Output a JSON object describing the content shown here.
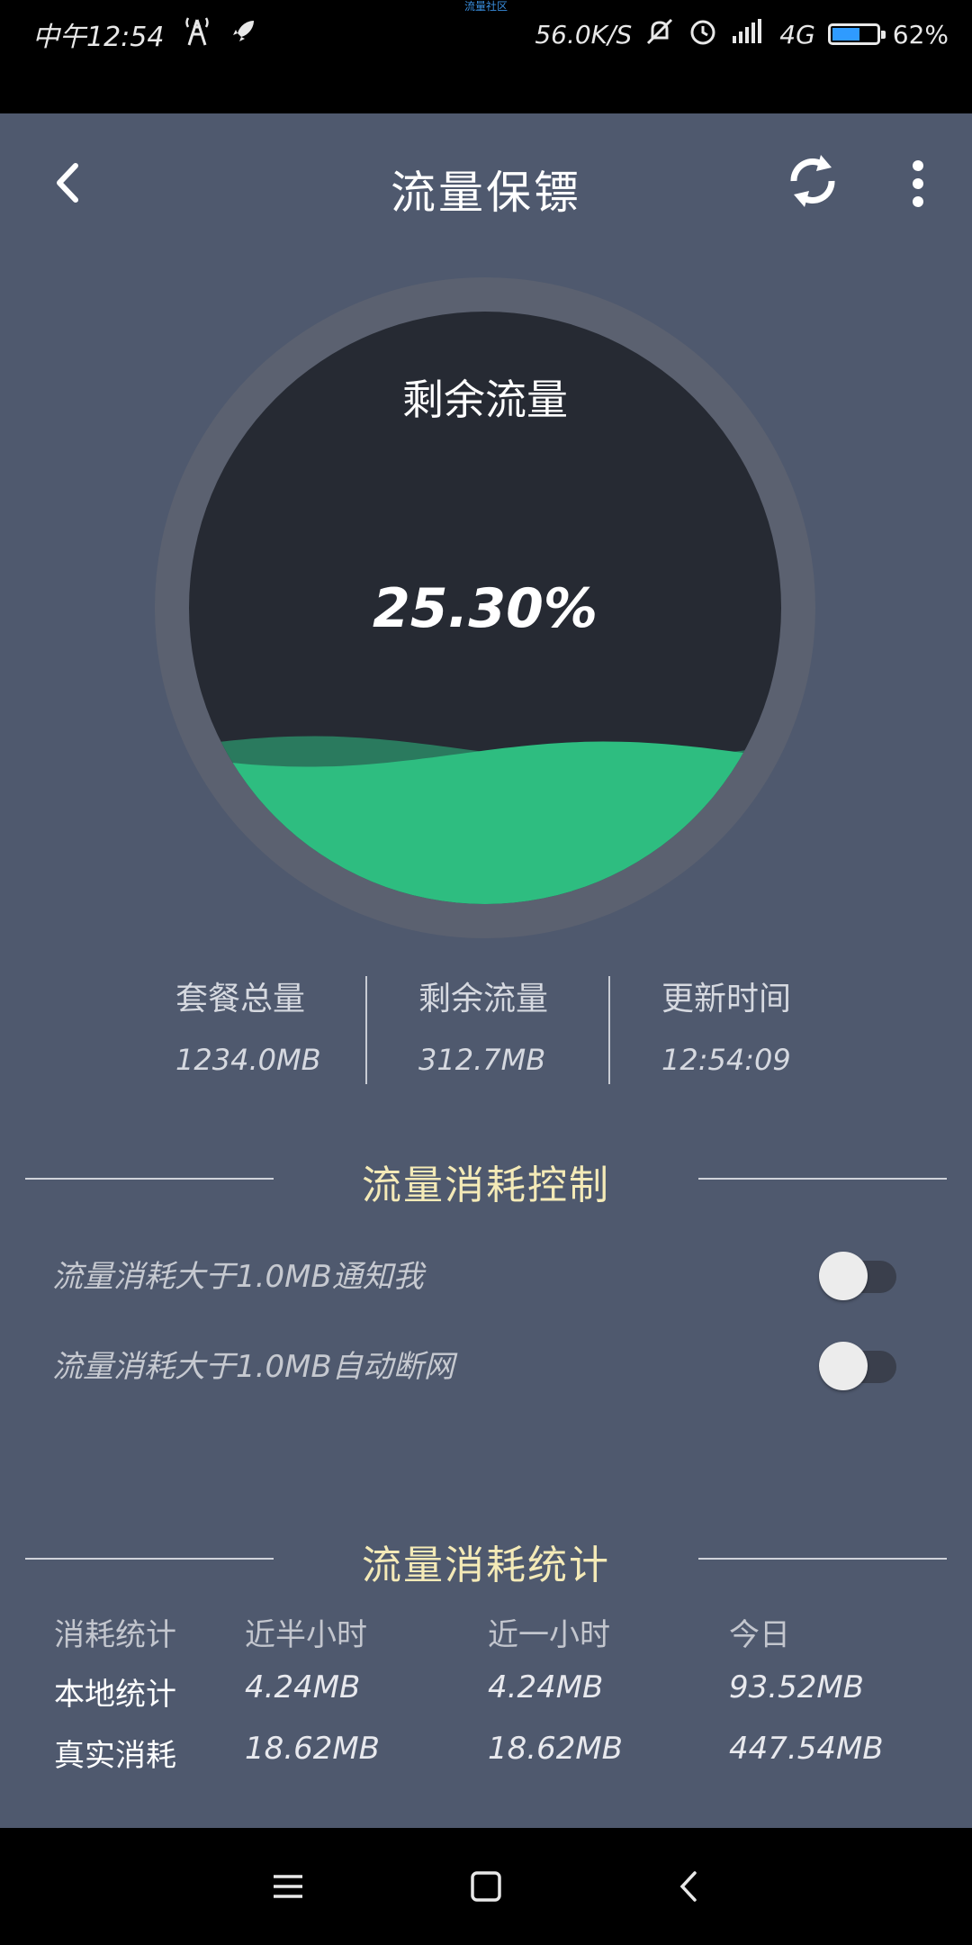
{
  "status_bar": {
    "carrier_tiny": "流量社区",
    "time": "中午12:54",
    "net_speed": "56.0K/S",
    "network": "4G",
    "battery_percent": "62%",
    "battery_level": 0.62
  },
  "appbar": {
    "title": "流量保镖"
  },
  "gauge": {
    "label": "剩余流量",
    "value": "25.30%",
    "fill_fraction": 0.253,
    "wave_color": "#2ebd80",
    "wave_back_color": "#2a7a5e"
  },
  "info": {
    "total_label": "套餐总量",
    "total_value": "1234.0MB",
    "remain_label": "剩余流量",
    "remain_value": "312.7MB",
    "update_label": "更新时间",
    "update_value": "12:54:09"
  },
  "control": {
    "heading": "流量消耗控制",
    "notify_label": "流量消耗大于1.0MB通知我",
    "notify_on": false,
    "cutoff_label": "流量消耗大于1.0MB自动断网",
    "cutoff_on": false
  },
  "stats": {
    "heading": "流量消耗统计",
    "headers": [
      "消耗统计",
      "近半小时",
      "近一小时",
      "今日"
    ],
    "rows": [
      {
        "label": "本地统计",
        "half_hour": "4.24MB",
        "one_hour": "4.24MB",
        "today": "93.52MB"
      },
      {
        "label": "真实消耗",
        "half_hour": "18.62MB",
        "one_hour": "18.62MB",
        "today": "447.54MB"
      }
    ]
  }
}
